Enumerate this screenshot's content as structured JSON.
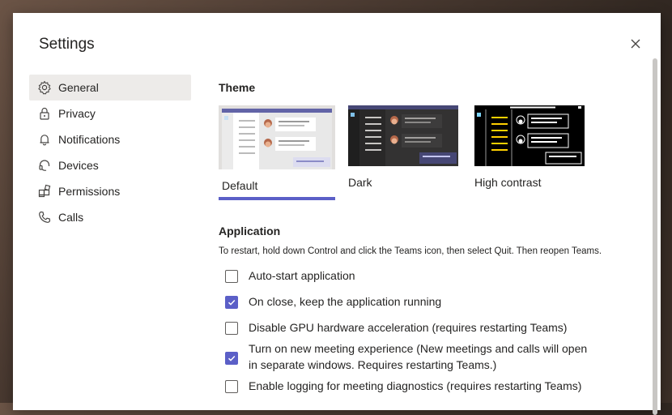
{
  "dialog": {
    "title": "Settings"
  },
  "icons": {
    "close": "close-icon"
  },
  "nav": {
    "items": [
      {
        "label": "General",
        "icon": "gear-icon",
        "active": true
      },
      {
        "label": "Privacy",
        "icon": "lock-icon"
      },
      {
        "label": "Notifications",
        "icon": "bell-icon"
      },
      {
        "label": "Devices",
        "icon": "headset-icon"
      },
      {
        "label": "Permissions",
        "icon": "apps-icon"
      },
      {
        "label": "Calls",
        "icon": "phone-icon"
      }
    ]
  },
  "theme": {
    "title": "Theme",
    "options": [
      {
        "label": "Default",
        "selected": true
      },
      {
        "label": "Dark"
      },
      {
        "label": "High contrast"
      }
    ]
  },
  "application": {
    "title": "Application",
    "description": "To restart, hold down Control and click the Teams icon, then select Quit. Then reopen Teams.",
    "options": [
      {
        "label": "Auto-start application",
        "checked": false
      },
      {
        "label": "On close, keep the application running",
        "checked": true
      },
      {
        "label": "Disable GPU hardware acceleration (requires restarting Teams)",
        "checked": false
      },
      {
        "label": "Turn on new meeting experience (New meetings and calls will open in separate windows. Requires restarting Teams.)",
        "checked": true
      },
      {
        "label": "Enable logging for meeting diagnostics (requires restarting Teams)",
        "checked": false
      }
    ]
  },
  "colors": {
    "accent": "#5b5fc7",
    "nav_active": "#edebe9"
  }
}
